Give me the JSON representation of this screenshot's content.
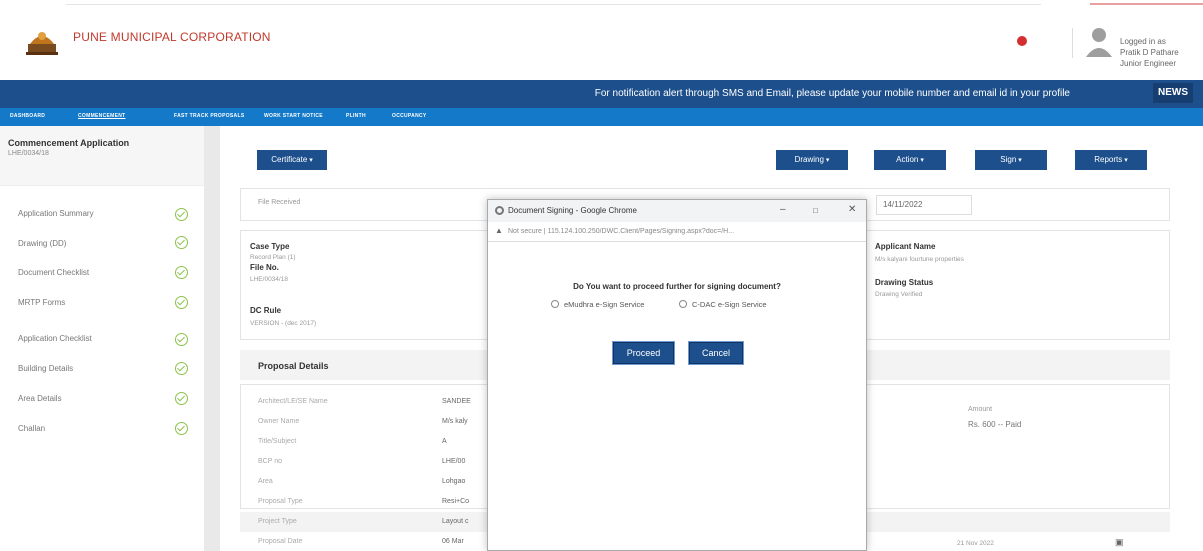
{
  "header": {
    "org_name": "PUNE MUNICIPAL CORPORATION",
    "user": {
      "logged_in_label": "Logged in as",
      "name": "Pratik D Pathare",
      "role": "Junior Engineer"
    }
  },
  "notification": {
    "text": "For notification alert through SMS and Email, please update your mobile number and email id in your profile",
    "news_label": "NEWS"
  },
  "nav": {
    "items": [
      "DASHBOARD",
      "COMMENCEMENT",
      "FAST TRACK PROPOSALS",
      "WORK START NOTICE",
      "PLINTH",
      "OCCUPANCY"
    ]
  },
  "sidebar": {
    "title": "Commencement Application",
    "file_no": "LHE/0034/18",
    "items": [
      "Application Summary",
      "Drawing (DD)",
      "Document Checklist",
      "MRTP Forms",
      "Application Checklist",
      "Building Details",
      "Area Details",
      "Challan"
    ]
  },
  "toolbar": {
    "certificate": "Certificate",
    "drawing": "Drawing",
    "action": "Action",
    "sign": "Sign",
    "reports": "Reports"
  },
  "status": {
    "file_received": "File Received",
    "date": "14/11/2022"
  },
  "summary": {
    "case_type_label": "Case Type",
    "case_type_value": "Record Plan (1)",
    "file_no_label": "File No.",
    "file_no_value": "LHE/0034/18",
    "dc_rule_label": "DC Rule",
    "dc_rule_value": "VERSION - (dec 2017)",
    "applicant_label": "Applicant Name",
    "applicant_value": "M/s kalyani fourtune properties",
    "drawing_status_label": "Drawing Status",
    "drawing_status_value": "Drawing Verified"
  },
  "proposal": {
    "title": "Proposal Details",
    "rows": [
      {
        "label": "Architect/LE/SE Name",
        "value": "SANDEE"
      },
      {
        "label": "Owner Name",
        "value": "M/s kaly"
      },
      {
        "label": "Title/Subject",
        "value": "A"
      },
      {
        "label": "BCP no",
        "value": "LHE/00"
      },
      {
        "label": "Area",
        "value": "Lohgao"
      },
      {
        "label": "Proposal Type",
        "value": "Resi+Co"
      },
      {
        "label": "Project Type",
        "value": "Layout c"
      },
      {
        "label": "Proposal Date",
        "value": "06 Mar"
      }
    ],
    "amount_label": "Amount",
    "amount_value": "Rs. 600 -- Paid",
    "bottom_date": "21 Nov 2022"
  },
  "dialog": {
    "window_title": "Document Signing - Google Chrome",
    "not_secure": "Not secure",
    "url": "115.124.100.250/DWC.Client/Pages/Signing.aspx?doc=/H...",
    "question": "Do You want to proceed further for signing document?",
    "option1": "eMudhra e-Sign Service",
    "option2": "C-DAC e-Sign Service",
    "proceed": "Proceed",
    "cancel": "Cancel"
  }
}
